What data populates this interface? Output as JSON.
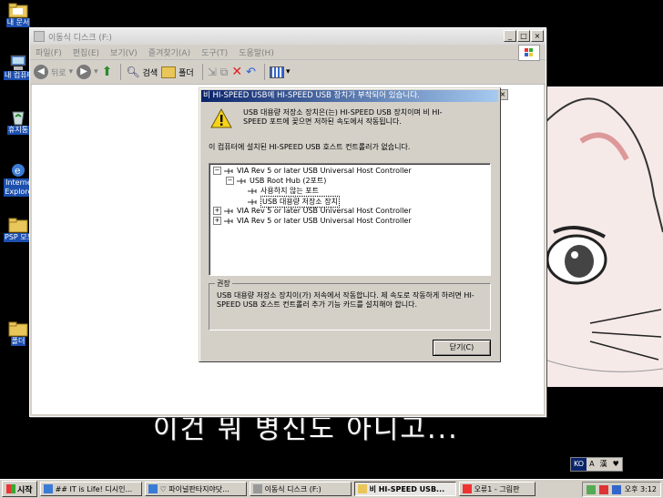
{
  "desktop": {
    "icons": [
      {
        "label": "내 문서",
        "icon": "folder-icon"
      },
      {
        "label": "내 컴퓨터",
        "icon": "computer-icon"
      },
      {
        "label": "휴지통",
        "icon": "recycle-bin-icon"
      },
      {
        "label": "Internet Explorer",
        "icon": "internet-explorer-icon"
      },
      {
        "label": "PSP 모드",
        "icon": "folder-icon"
      },
      {
        "label": "폴더",
        "icon": "folder-icon"
      }
    ],
    "subtitle": "이건 뭐 병신도 아니고..."
  },
  "explorer": {
    "title": "이동식 디스크 (F:)",
    "menu": [
      "파일(F)",
      "편집(E)",
      "보기(V)",
      "즐겨찾기(A)",
      "도구(T)",
      "도움말(H)"
    ],
    "toolbar": {
      "back": "뒤로",
      "search": "검색",
      "folders": "폴더"
    }
  },
  "dialog": {
    "title": "비 HI-SPEED USB에 HI-SPEED USB 장치가 부착되어 있습니다.",
    "message": "USB 대용량 저장소 장치은(는) HI-SPEED USB 장치이며 비 HI-SPEED 포트에 꽂으면 저하된 속도에서 작동됩니다.",
    "info": "이 컴퓨터에 설치된 HI-SPEED USB 호스트 컨트롤러가 없습니다.",
    "tree": [
      {
        "label": "VIA Rev 5 or later USB Universal Host Controller",
        "expander": "−",
        "level": 0
      },
      {
        "label": "USB Root Hub (2포트)",
        "expander": "−",
        "level": 1
      },
      {
        "label": "사용하지 않는 포트",
        "expander": "",
        "level": 2
      },
      {
        "label": "USB 대용량 저장소 장치",
        "expander": "",
        "level": 2,
        "selected": true
      },
      {
        "label": "VIA Rev 5 or later USB Universal Host Controller",
        "expander": "+",
        "level": 0
      },
      {
        "label": "VIA Rev 5 or later USB Universal Host Controller",
        "expander": "+",
        "level": 0
      }
    ],
    "recommendation_title": "권장",
    "recommendation": "USB 대용량 저장소 장치이(가) 저속에서 작동합니다. 제 속도로 작동하게 하려면 HI-SPEED USB 호스트 컨트롤러 추가 기능 카드를 설치해야 합니다.",
    "close_label": "닫기(C)"
  },
  "ime": {
    "items": [
      "KO",
      "A",
      "漢",
      "♥"
    ]
  },
  "taskbar": {
    "start_label": "시작",
    "tasks": [
      {
        "label": "## IT is Life! 디시인...",
        "active": false
      },
      {
        "label": "♡ 파이널판타지야닷...",
        "active": false
      },
      {
        "label": "이동식 디스크 (F:)",
        "active": false
      },
      {
        "label": "비 HI-SPEED USB...",
        "active": true
      },
      {
        "label": "오류1 - 그림판",
        "active": false
      }
    ],
    "clock": "오후 3:12"
  }
}
